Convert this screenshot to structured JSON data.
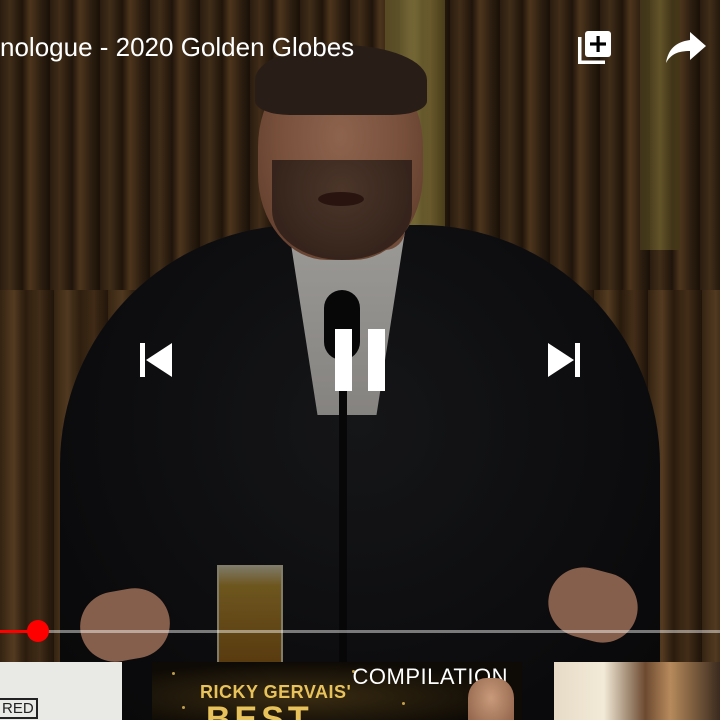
{
  "video": {
    "title": "nologue - 2020 Golden Globes",
    "progress_fraction": 0.053
  },
  "top_bar": {
    "add_to_playlist_icon": "add-to-playlist-icon",
    "share_icon": "share-icon"
  },
  "controls": {
    "previous_icon": "skip-previous-icon",
    "pause_icon": "pause-icon",
    "next_icon": "skip-next-icon"
  },
  "thumbnails": [
    {
      "text": "RED"
    },
    {
      "badge": "COMPILATION",
      "line1": "RICKY GERVAIS'",
      "line2": "BEST"
    },
    {
      "text": ""
    }
  ],
  "colors": {
    "progress": "#ff0000",
    "accent_gold": "#e8c25a"
  }
}
